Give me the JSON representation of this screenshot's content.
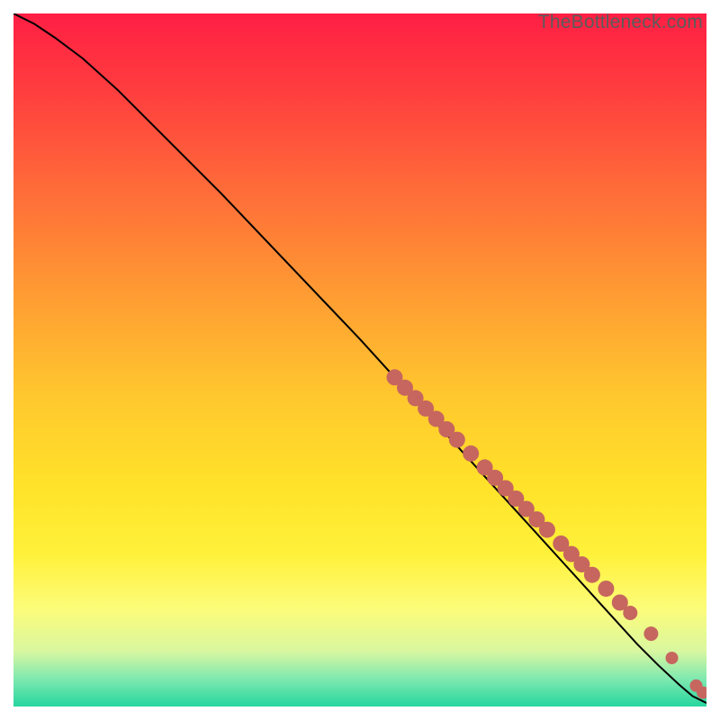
{
  "watermark": "TheBottleneck.com",
  "chart_data": {
    "type": "line",
    "title": "",
    "xlabel": "",
    "ylabel": "",
    "xlim": [
      0,
      100
    ],
    "ylim": [
      0,
      100
    ],
    "grid": false,
    "legend": false,
    "background": "vertical-gradient red→orange→yellow→green",
    "series": [
      {
        "name": "curve",
        "x": [
          0,
          3,
          6,
          10,
          15,
          20,
          30,
          40,
          50,
          55,
          60,
          65,
          70,
          75,
          80,
          85,
          90,
          93,
          96,
          98,
          100
        ],
        "y": [
          100,
          98.5,
          96.5,
          93.5,
          89,
          84,
          74,
          63.5,
          53,
          47.5,
          42,
          36.5,
          31,
          25.5,
          20,
          14.5,
          9,
          6,
          3.2,
          1.5,
          0.5
        ]
      }
    ],
    "markers": {
      "name": "cluster-points",
      "color": "#c6665f",
      "radius_default": 9,
      "points": [
        {
          "x": 55.0,
          "y": 47.5,
          "r": 9
        },
        {
          "x": 56.5,
          "y": 46.0,
          "r": 9
        },
        {
          "x": 58.0,
          "y": 44.5,
          "r": 9
        },
        {
          "x": 59.5,
          "y": 43.0,
          "r": 9
        },
        {
          "x": 61.0,
          "y": 41.5,
          "r": 9
        },
        {
          "x": 62.5,
          "y": 40.0,
          "r": 9
        },
        {
          "x": 64.0,
          "y": 38.5,
          "r": 9
        },
        {
          "x": 66.0,
          "y": 36.5,
          "r": 9
        },
        {
          "x": 68.0,
          "y": 34.5,
          "r": 9
        },
        {
          "x": 69.5,
          "y": 33.0,
          "r": 9
        },
        {
          "x": 71.0,
          "y": 31.5,
          "r": 9
        },
        {
          "x": 72.5,
          "y": 30.0,
          "r": 9
        },
        {
          "x": 74.0,
          "y": 28.5,
          "r": 9
        },
        {
          "x": 75.5,
          "y": 27.0,
          "r": 9
        },
        {
          "x": 77.0,
          "y": 25.5,
          "r": 9
        },
        {
          "x": 79.0,
          "y": 23.5,
          "r": 9
        },
        {
          "x": 80.5,
          "y": 22.0,
          "r": 9
        },
        {
          "x": 82.0,
          "y": 20.5,
          "r": 9
        },
        {
          "x": 83.5,
          "y": 19.0,
          "r": 9
        },
        {
          "x": 85.5,
          "y": 17.0,
          "r": 9
        },
        {
          "x": 87.5,
          "y": 15.0,
          "r": 9
        },
        {
          "x": 89.0,
          "y": 13.5,
          "r": 8
        },
        {
          "x": 92.0,
          "y": 10.5,
          "r": 8
        },
        {
          "x": 95.0,
          "y": 7.0,
          "r": 7
        },
        {
          "x": 98.5,
          "y": 3.0,
          "r": 7
        },
        {
          "x": 99.5,
          "y": 2.0,
          "r": 7
        }
      ]
    }
  }
}
